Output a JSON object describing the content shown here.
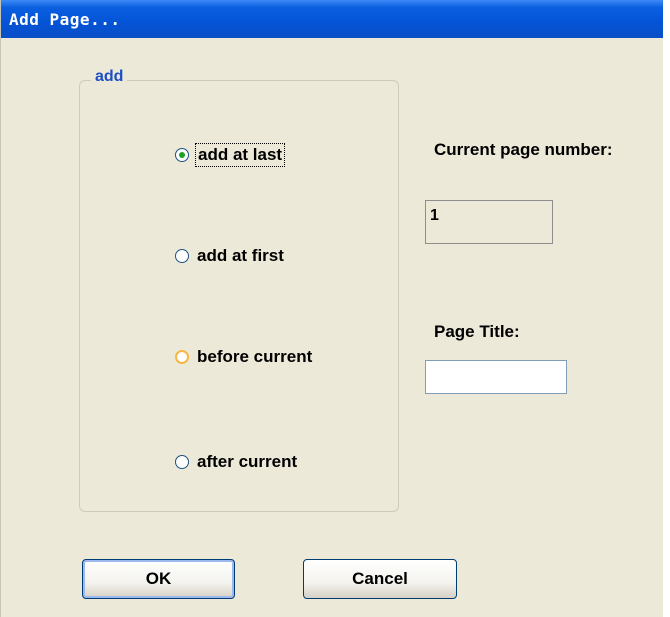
{
  "window": {
    "title": "Add Page..."
  },
  "group": {
    "legend": "add",
    "options": [
      {
        "label": "add at last",
        "checked": true
      },
      {
        "label": "add at first",
        "checked": false
      },
      {
        "label": "before current",
        "checked": false
      },
      {
        "label": "after current",
        "checked": false
      }
    ]
  },
  "current_page": {
    "label": "Current page number:",
    "value": "1"
  },
  "page_title": {
    "label": "Page Title:",
    "value": ""
  },
  "buttons": {
    "ok": "OK",
    "cancel": "Cancel"
  },
  "colors": {
    "titlebar": "#0a5fe0",
    "dialog_bg": "#ece9d8",
    "legend_text": "#1c4fc4",
    "radio_selected": "#21a121"
  }
}
